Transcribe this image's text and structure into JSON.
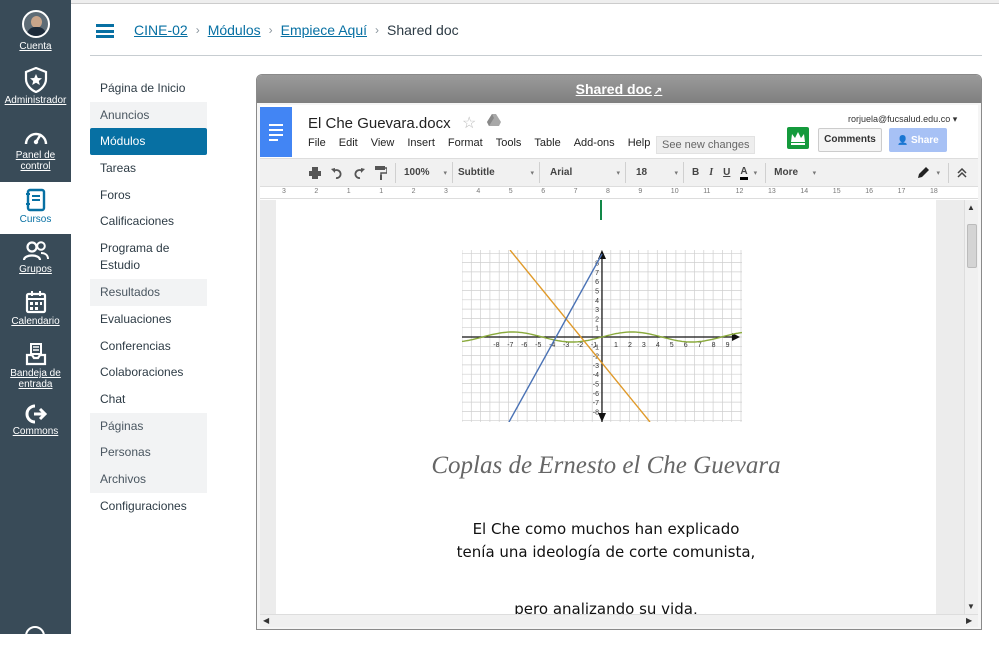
{
  "global_nav": {
    "items": [
      {
        "label": "Cuenta",
        "icon": "avatar"
      },
      {
        "label": "Administrador",
        "icon": "shield-star-icon"
      },
      {
        "label": "Panel de control",
        "icon": "dashboard-icon"
      },
      {
        "label": "Cursos",
        "icon": "book-icon"
      },
      {
        "label": "Grupos",
        "icon": "people-icon"
      },
      {
        "label": "Calendario",
        "icon": "calendar-icon"
      },
      {
        "label": "Bandeja de entrada",
        "icon": "inbox-icon"
      },
      {
        "label": "Commons",
        "icon": "commons-icon"
      }
    ],
    "colors": {
      "background": "#394b58",
      "active": "#0770a3"
    }
  },
  "breadcrumb": {
    "items": [
      "CINE-02",
      "Módulos",
      "Empiece Aquí"
    ],
    "current": "Shared doc"
  },
  "course_nav": {
    "items": [
      {
        "label": "Página de Inicio",
        "state": "normal"
      },
      {
        "label": "Anuncios",
        "state": "hidden"
      },
      {
        "label": "Módulos",
        "state": "active"
      },
      {
        "label": "Tareas",
        "state": "normal"
      },
      {
        "label": "Foros",
        "state": "normal"
      },
      {
        "label": "Calificaciones",
        "state": "normal"
      },
      {
        "label": "Programa de Estudio",
        "state": "normal"
      },
      {
        "label": "Resultados",
        "state": "hidden"
      },
      {
        "label": "Evaluaciones",
        "state": "normal"
      },
      {
        "label": "Conferencias",
        "state": "normal"
      },
      {
        "label": "Colaboraciones",
        "state": "normal"
      },
      {
        "label": "Chat",
        "state": "normal"
      },
      {
        "label": "Páginas",
        "state": "hidden"
      },
      {
        "label": "Personas",
        "state": "hidden"
      },
      {
        "label": "Archivos",
        "state": "hidden"
      },
      {
        "label": "Configuraciones",
        "state": "normal"
      }
    ]
  },
  "frame": {
    "title": "Shared doc",
    "external_icon": "↗"
  },
  "gdocs": {
    "doc_name": "El Che Guevara.docx",
    "star": "☆",
    "menus": [
      "File",
      "Edit",
      "View",
      "Insert",
      "Format",
      "Tools",
      "Table",
      "Add-ons",
      "Help"
    ],
    "see_changes": "See new changes",
    "email": "rorjuela@fucsalud.edu.co ▾",
    "comments_label": "Comments",
    "share_label": "Share",
    "toolbar": {
      "zoom": "100%",
      "style": "Subtitle",
      "font": "Arial",
      "size": "18",
      "bold": "B",
      "italic": "I",
      "underline": "U",
      "text_color": "A",
      "more": "More"
    },
    "ruler_labels": [
      "3",
      "2",
      "1",
      "1",
      "2",
      "3",
      "4",
      "5",
      "6",
      "7",
      "8",
      "9",
      "10",
      "11",
      "12",
      "13",
      "14",
      "15",
      "16",
      "17",
      "18"
    ]
  },
  "document": {
    "title": "Coplas de Ernesto el Che Guevara",
    "lines": [
      "El Che como muchos han explicado",
      "tenía una ideología de corte comunista,",
      "pero analizando su vida,"
    ],
    "graph_labels": {
      "x_neg": [
        "-8",
        "-7",
        "-6",
        "-5",
        "-4",
        "-3",
        "-2",
        "-1"
      ],
      "x_pos": [
        "1",
        "2",
        "3",
        "4",
        "5",
        "6",
        "7",
        "8",
        "9"
      ],
      "y_pos": [
        "8",
        "7",
        "6",
        "5",
        "4",
        "3",
        "2",
        "1"
      ],
      "y_neg": [
        "-1",
        "-2",
        "-3",
        "-4",
        "-5",
        "-6",
        "-7",
        "-8"
      ]
    },
    "graph_colors": {
      "line_blue": "#4a72b5",
      "line_orange": "#e09a2a",
      "wave": "#8aaa3c"
    }
  }
}
